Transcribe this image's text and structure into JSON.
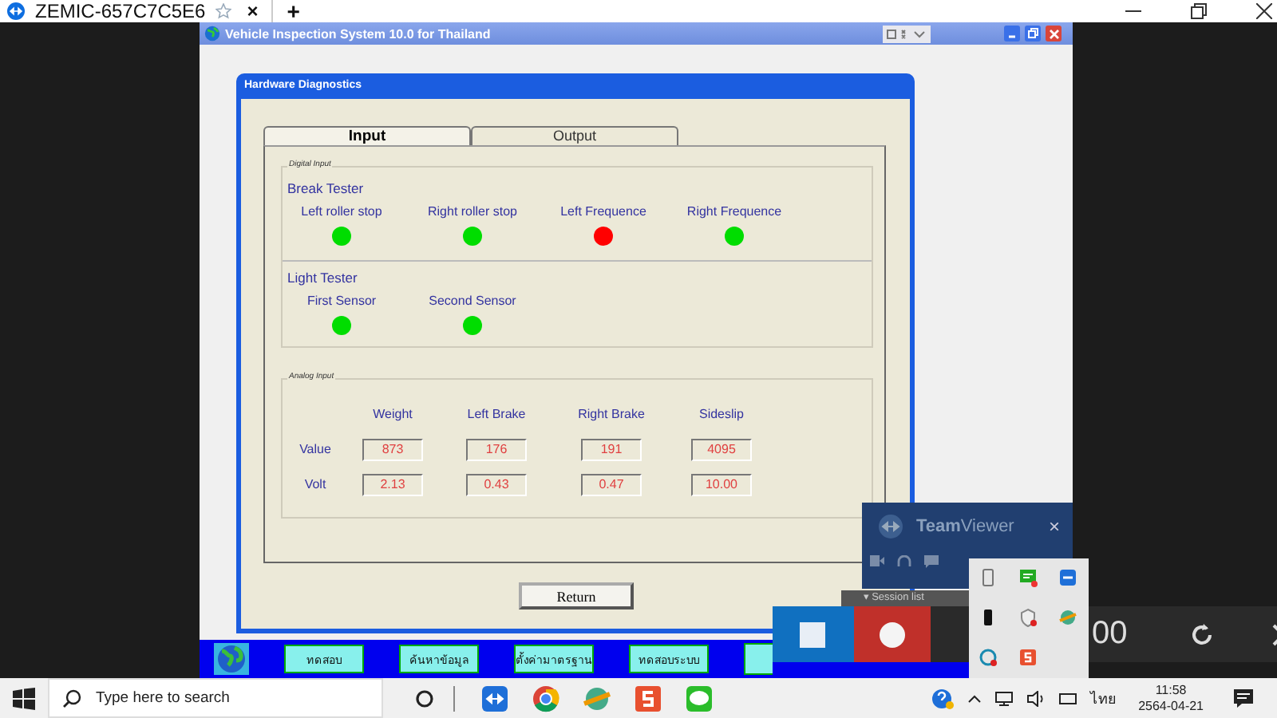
{
  "browser_tab": {
    "title": "ZEMIC-657C7C5E6",
    "close": "×",
    "new_tab": "+"
  },
  "app_window": {
    "title": "Vehicle Inspection System 10.0 for Thailand"
  },
  "dialog": {
    "title": "Hardware Diagnostics",
    "tabs": [
      {
        "label": "Input",
        "selected": true
      },
      {
        "label": "Output",
        "selected": false
      }
    ],
    "digital_input": {
      "legend": "Digital Input",
      "groups": [
        {
          "title": "Break Tester",
          "sensors": [
            {
              "label": "Left roller stop",
              "color": "#00dd00"
            },
            {
              "label": "Right roller stop",
              "color": "#00dd00"
            },
            {
              "label": "Left Frequence",
              "color": "#ff0000"
            },
            {
              "label": "Right Frequence",
              "color": "#00dd00"
            }
          ]
        },
        {
          "title": "Light Tester",
          "sensors": [
            {
              "label": "First Sensor",
              "color": "#00dd00"
            },
            {
              "label": "Second Sensor",
              "color": "#00dd00"
            }
          ]
        }
      ]
    },
    "analog_input": {
      "legend": "Analog Input",
      "columns": [
        "Weight",
        "Left Brake",
        "Right Brake",
        "Sideslip"
      ],
      "rows": [
        {
          "label": "Value",
          "values": [
            "873",
            "176",
            "191",
            "4095"
          ]
        },
        {
          "label": "Volt",
          "values": [
            "2.13",
            "0.43",
            "0.47",
            "10.00"
          ]
        }
      ]
    },
    "return_button": "Return"
  },
  "bottom_buttons": [
    "ทดสอบ",
    "ค้นหาข้อมูล",
    "ตั้งค่ามาตรฐาน",
    "ทดสอบระบบ"
  ],
  "teamviewer_panel": {
    "brand_bold": "Team",
    "brand_rest": "Viewer",
    "close": "×",
    "session_list": "▾ Session list"
  },
  "remote_bar": {
    "counter": "00"
  },
  "taskbar": {
    "search_placeholder": "Type here to search",
    "language": "ไทย",
    "time": "11:58",
    "date": "2564-04-21"
  }
}
